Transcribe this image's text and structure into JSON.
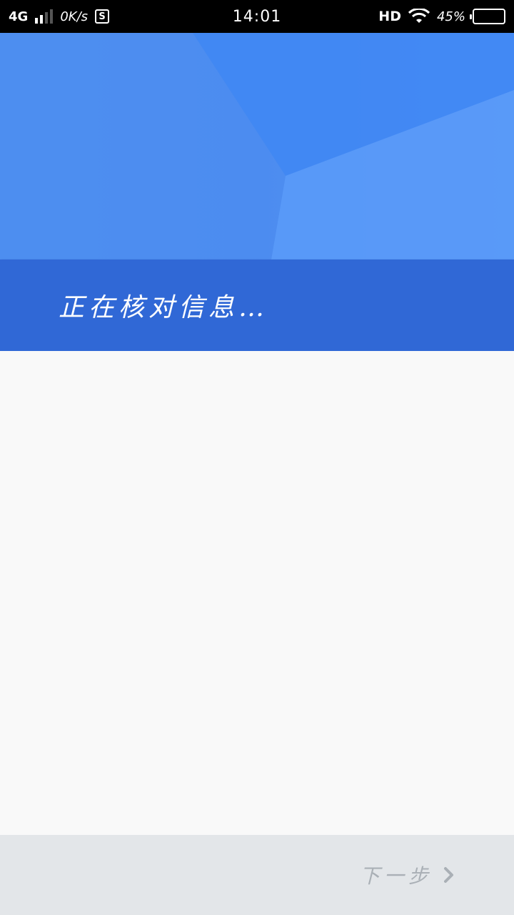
{
  "status_bar": {
    "network": "4G",
    "speed": "0K/s",
    "s_badge": "S",
    "time": "14:01",
    "hd": "HD",
    "battery_percent": "45%",
    "battery_level": 0.45
  },
  "header": {
    "title": "正在核对信息…"
  },
  "footer": {
    "next_label": "下一步"
  },
  "colors": {
    "hero_blue": "#4d8ff0",
    "band_blue": "#3068d6",
    "footer_bg": "#e3e6e9",
    "next_text": "#aab0b6"
  }
}
